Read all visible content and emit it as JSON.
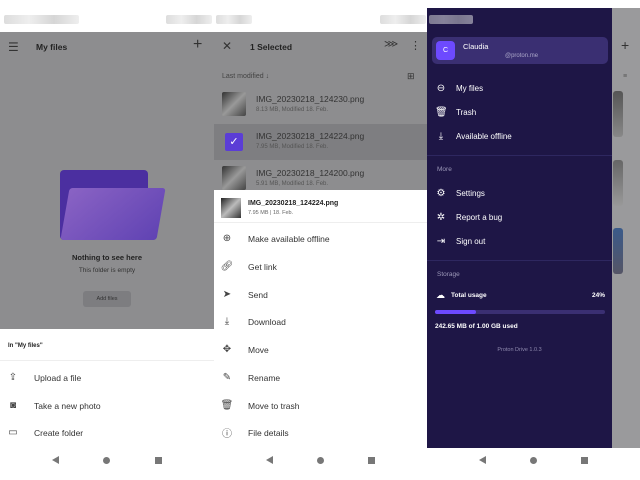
{
  "panel1": {
    "title": "My files",
    "empty_title": "Nothing to see here",
    "empty_subtitle": "This folder is empty",
    "add_files": "Add files",
    "sheet_title": "In \"My files\"",
    "items": [
      {
        "label": "Upload a file",
        "icon": "upload-file-icon"
      },
      {
        "label": "Take a new photo",
        "icon": "camera-icon"
      },
      {
        "label": "Create folder",
        "icon": "create-folder-icon"
      }
    ]
  },
  "panel2": {
    "title": "1 Selected",
    "sort_label": "Last modified",
    "files": [
      {
        "name": "IMG_20230218_124230.png",
        "meta": "8.13 MB, Modified 18. Feb."
      },
      {
        "name": "IMG_20230218_124224.png",
        "meta": "7.95 MB, Modified 18. Feb."
      },
      {
        "name": "IMG_20230218_124200.png",
        "meta": "5.91 MB, Modified 18. Feb."
      }
    ],
    "sheet_file": {
      "name": "IMG_20230218_124224.png",
      "meta": "7.95 MB | 18. Feb."
    },
    "actions": [
      {
        "label": "Make available offline",
        "icon": "offline-icon"
      },
      {
        "label": "Get link",
        "icon": "link-icon"
      },
      {
        "label": "Send",
        "icon": "send-icon"
      },
      {
        "label": "Download",
        "icon": "download-icon"
      },
      {
        "label": "Move",
        "icon": "move-icon"
      },
      {
        "label": "Rename",
        "icon": "rename-icon"
      },
      {
        "label": "Move to trash",
        "icon": "trash-icon"
      },
      {
        "label": "File details",
        "icon": "info-icon"
      }
    ]
  },
  "drawer": {
    "avatar_letter": "C",
    "user_name": "Claudia",
    "user_email": "@proton.me",
    "nav": [
      {
        "label": "My files"
      },
      {
        "label": "Trash"
      },
      {
        "label": "Available offline"
      }
    ],
    "more_label": "More",
    "more": [
      {
        "label": "Settings"
      },
      {
        "label": "Report a bug"
      },
      {
        "label": "Sign out"
      }
    ],
    "storage_label": "Storage",
    "total_usage": "Total usage",
    "usage_percent_text": "24%",
    "usage_fraction": 0.24,
    "used_text": "242.65 MB of 1.00 GB used",
    "version": "Proton Drive 1.0.3"
  },
  "colors": {
    "accent": "#6d4aff",
    "drawer_bg": "#1e1646",
    "overlay": "#8d8d8f"
  }
}
